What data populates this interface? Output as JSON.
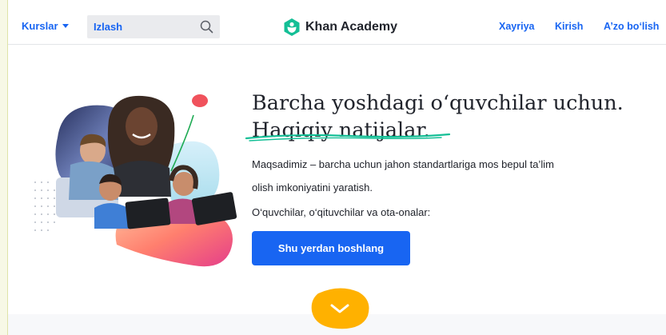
{
  "header": {
    "courses_label": "Kurslar",
    "search": {
      "placeholder": "Izlash"
    },
    "brand": {
      "name": "Khan Academy"
    },
    "links": [
      "Xayriya",
      "Kirish",
      "A’zo bo‘lish"
    ]
  },
  "hero": {
    "headline_line1": "Barcha yoshdagi o‘quvchilar uchun.",
    "headline_line2": "Haqiqiy natijalar.",
    "mission_line1": "Maqsadimiz – barcha uchun jahon standartlariga mos bepul ta’lim",
    "mission_line2": "olish imkoniyatini yaratish.",
    "audience": "O‘quvchilar, o‘qituvchilar va ota-onalar:",
    "cta_label": "Shu yerdan boshlang"
  },
  "colors": {
    "accent": "#1865f2",
    "brand_green": "#14bf96",
    "scroll_badge": "#ffb100"
  }
}
